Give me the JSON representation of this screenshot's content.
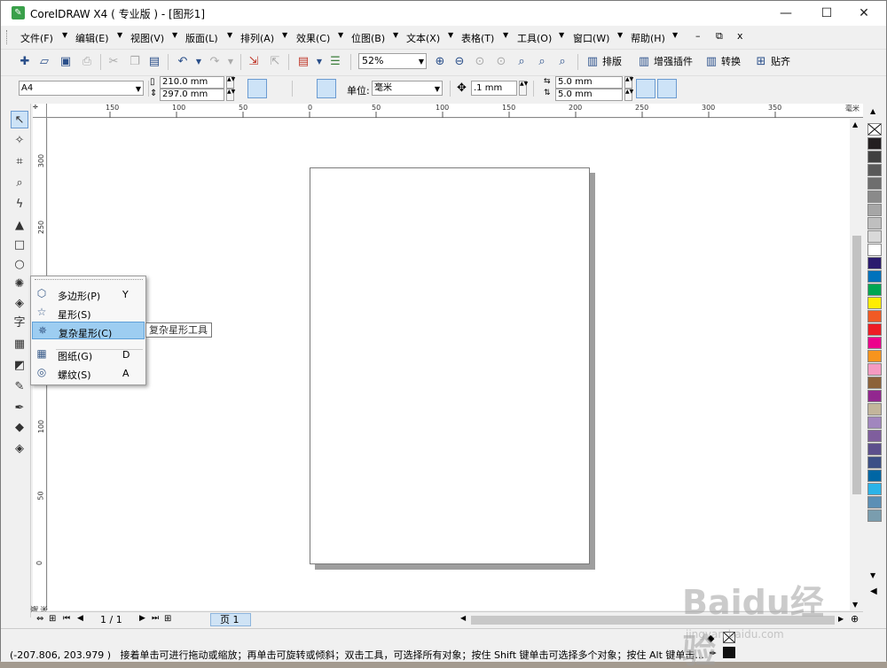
{
  "window": {
    "title": "CorelDRAW X4 ( 专业版 ) - [图形1]",
    "controls": {
      "minimize": "—",
      "maximize": "☐",
      "close": "✕"
    }
  },
  "menubar": {
    "items": [
      "文件(F)",
      "编辑(E)",
      "视图(V)",
      "版面(L)",
      "排列(A)",
      "效果(C)",
      "位图(B)",
      "文本(X)",
      "表格(T)",
      "工具(O)",
      "窗口(W)",
      "帮助(H)"
    ],
    "mdi": {
      "minimize": "–",
      "restore": "⧉",
      "close": "x"
    }
  },
  "toolbar": {
    "zoom": "52%",
    "buttons": [
      "排版",
      "增强插件",
      "转换",
      "贴齐"
    ]
  },
  "property_bar": {
    "paper_size": "A4",
    "width": "210.0 mm",
    "height": "297.0 mm",
    "unit_label": "单位:",
    "unit_value": "毫米",
    "nudge": ".1 mm",
    "dup_x": "5.0 mm",
    "dup_y": "5.0 mm"
  },
  "ruler": {
    "h_labels": [
      "150",
      "100",
      "50",
      "0",
      "50",
      "100",
      "150",
      "200",
      "250",
      "300",
      "350"
    ],
    "h_unit": "毫米",
    "v_labels": [
      "300",
      "250",
      "200",
      "150",
      "100",
      "50",
      "0"
    ],
    "v_unit": "毫米"
  },
  "flyout": {
    "items": [
      {
        "icon": "polygon-icon",
        "glyph": "⬡",
        "label": "多边形(P)",
        "key": "Y"
      },
      {
        "icon": "star-icon",
        "glyph": "☆",
        "label": "星形(S)",
        "key": ""
      },
      {
        "icon": "complex-star-icon",
        "glyph": "✵",
        "label": "复杂星形(C)",
        "key": ""
      },
      {
        "icon": "graph-paper-icon",
        "glyph": "▦",
        "label": "图纸(G)",
        "key": "D"
      },
      {
        "icon": "spiral-icon",
        "glyph": "◎",
        "label": "螺纹(S)",
        "key": "A"
      }
    ],
    "tooltip": "复杂星形工具"
  },
  "pager": {
    "count": "1 / 1",
    "tab": "页 1"
  },
  "status": {
    "coords": "(-207.806, 203.979 )",
    "hint": "接着单击可进行拖动或缩放；再单击可旋转或倾斜；双击工具，可选择所有对象；按住 Shift 键单击可选择多个对象；按住 Alt 键单击..."
  },
  "palette": {
    "colors": [
      "#231f20",
      "#404040",
      "#595959",
      "#6e6e6e",
      "#8a8a8a",
      "#a6a6a6",
      "#bfbfbf",
      "#d9d9d9",
      "#ffffff",
      "#2a1a6e",
      "#0072bc",
      "#00a651",
      "#ffed00",
      "#f15a24",
      "#ed1c24",
      "#ec008c",
      "#f7941d",
      "#f49ac1",
      "#8c6239",
      "#92278f",
      "#c2b59b",
      "#a186be",
      "#7f5e9d",
      "#5c4f8c",
      "#3c4f86",
      "#0066a4",
      "#2bb3e8",
      "#5b8fb5",
      "#7a9dae"
    ]
  },
  "watermark": {
    "main": "Baidu经验",
    "sub": "jingyan.baidu.com"
  }
}
